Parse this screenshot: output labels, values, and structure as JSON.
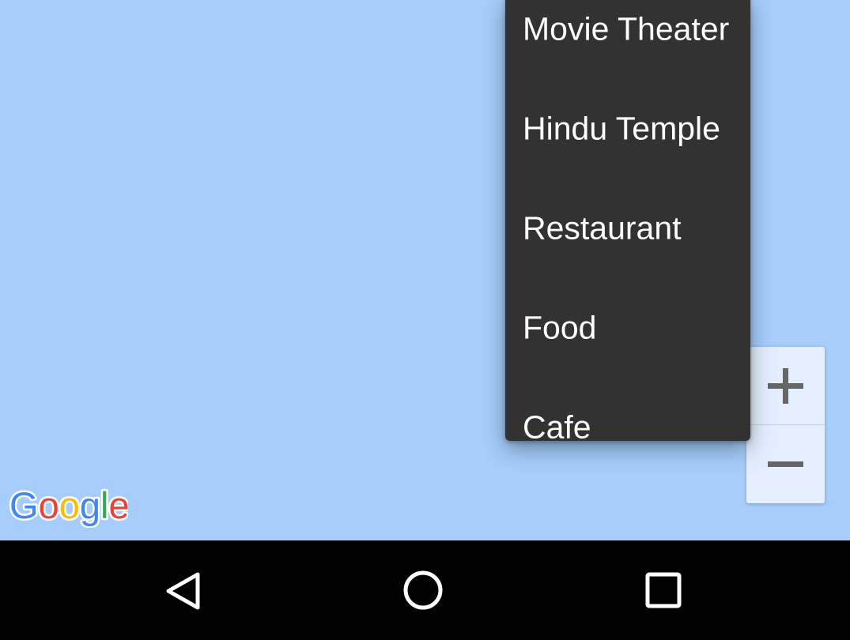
{
  "map": {
    "logo_text": "Google",
    "water_color": "#a6cdfc"
  },
  "dropdown": {
    "items": [
      {
        "label": "Movie Theater"
      },
      {
        "label": "Hindu Temple"
      },
      {
        "label": "Restaurant"
      },
      {
        "label": "Food"
      },
      {
        "label": "Cafe"
      }
    ]
  },
  "zoom": {
    "zoom_in_icon": "plus-icon",
    "zoom_out_icon": "minus-icon"
  },
  "navbar": {
    "back_icon": "back-triangle-icon",
    "home_icon": "home-circle-icon",
    "recents_icon": "recents-square-icon"
  }
}
